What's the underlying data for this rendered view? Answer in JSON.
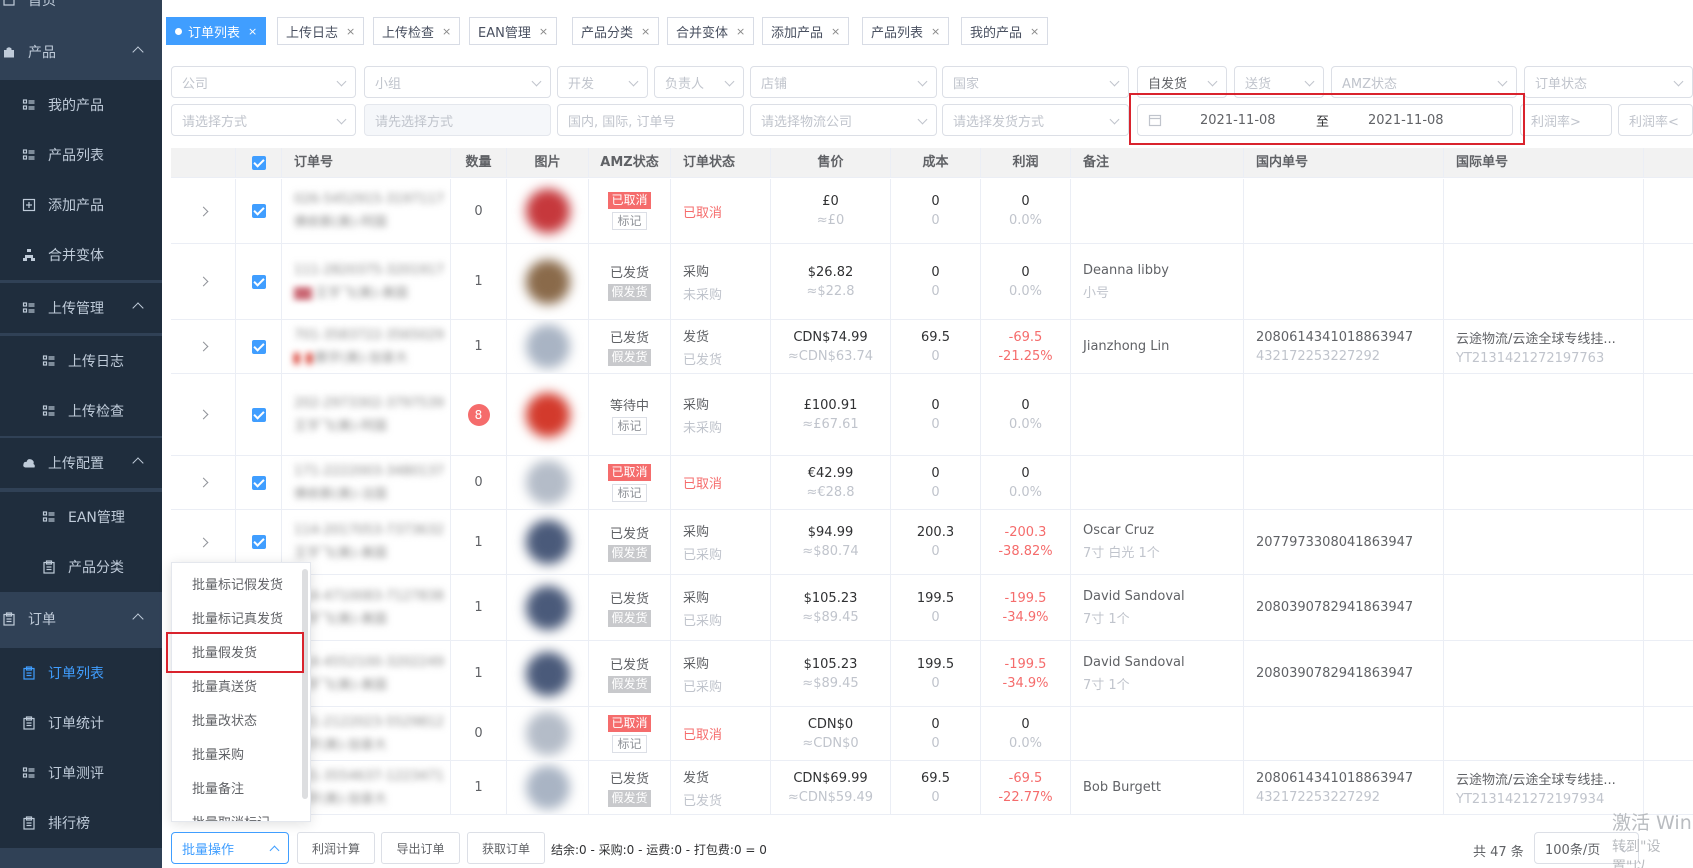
{
  "sidebar": {
    "items": [
      {
        "label": "首页",
        "icon": "home-icon"
      },
      {
        "label": "产品",
        "icon": "bag-icon"
      },
      {
        "label": "我的产品",
        "icon": "list-icon"
      },
      {
        "label": "产品列表",
        "icon": "list-icon"
      },
      {
        "label": "添加产品",
        "icon": "add-box-icon"
      },
      {
        "label": "合并变体",
        "icon": "tree-icon"
      },
      {
        "label": "上传管理",
        "icon": "list-icon"
      },
      {
        "label": "上传日志",
        "icon": "list-icon"
      },
      {
        "label": "上传检查",
        "icon": "list-icon"
      },
      {
        "label": "上传配置",
        "icon": "cloud-upload-icon"
      },
      {
        "label": "EAN管理",
        "icon": "list-icon"
      },
      {
        "label": "产品分类",
        "icon": "clipboard-icon"
      },
      {
        "label": "订单",
        "icon": "clipboard-icon"
      },
      {
        "label": "订单列表",
        "icon": "clipboard-icon"
      },
      {
        "label": "订单统计",
        "icon": "clipboard-icon"
      },
      {
        "label": "订单测评",
        "icon": "list-icon"
      },
      {
        "label": "排行榜",
        "icon": "clipboard-icon"
      }
    ]
  },
  "tabs": [
    "订单列表",
    "上传日志",
    "上传检查",
    "EAN管理",
    "产品分类",
    "合并变体",
    "添加产品",
    "产品列表",
    "我的产品"
  ],
  "filters": {
    "company": "公司",
    "group": "小组",
    "developer": "开发",
    "owner": "负责人",
    "shop": "店铺",
    "country": "国家",
    "ship_type": "自发货",
    "delivery": "送货",
    "amz_status": "AMZ状态",
    "order_status": "订单状态",
    "method": "请选择方式",
    "method2": "请先选择方式",
    "order_no": "国内, 国际, 订单号",
    "logistics": "请选择物流公司",
    "ship_method": "请选择发货方式",
    "date_from": "2021-11-08",
    "date_sep": "至",
    "date_to": "2021-11-08",
    "profit_gt": "利润率>",
    "profit_lt": "利润率<"
  },
  "table": {
    "headers": [
      "订单号",
      "数量",
      "图片",
      "AMZ状态",
      "订单状态",
      "售价",
      "成本",
      "利润",
      "备注",
      "国内单号",
      "国际单号"
    ],
    "rows": [
      {
        "order": "026-5452915-3197117",
        "sub": "佛依斯(美)-阿国",
        "qty": "0",
        "amz": "已取消",
        "amz2": "标记",
        "amz_type": "cancel",
        "st": "已取消",
        "st2": "",
        "st_red": true,
        "price": "£0",
        "price2": "≈£0",
        "cost": "0",
        "cost2": "0",
        "profit": "0",
        "profit2": "0.0%",
        "neg": false,
        "note": "",
        "note2": "",
        "dom": "",
        "dom2": "",
        "intl": "",
        "intl2": "",
        "img": "#c6383c",
        "flag": ""
      },
      {
        "order": "111-2820375-3201917",
        "sub": "王宇飞(美)-美国",
        "qty": "1",
        "amz": "已发货",
        "amz2": "假发货",
        "amz_type": "shipped",
        "st": "采购",
        "st2": "未采购",
        "st_red": false,
        "price": "$26.82",
        "price2": "≈$22.8",
        "cost": "0",
        "cost2": "0",
        "profit": "0",
        "profit2": "0.0%",
        "neg": false,
        "note": "Deanna libby",
        "note2": "小号",
        "dom": "",
        "dom2": "",
        "intl": "",
        "intl2": "",
        "img": "#8a6a4a",
        "flag": "us"
      },
      {
        "order": "701-3583722-3565029",
        "sub": "鹏宇(美)-加拿大",
        "qty": "1",
        "amz": "已发货",
        "amz2": "假发货",
        "amz_type": "shipped",
        "st": "发货",
        "st2": "已发货",
        "st_red": false,
        "price": "CDN$74.99",
        "price2": "≈CDN$63.74",
        "cost": "69.5",
        "cost2": "0",
        "profit": "-69.5",
        "profit2": "-21.25%",
        "neg": true,
        "note": "Jianzhong Lin",
        "note2": "",
        "dom": "2080614341018863947",
        "dom2": "432172253227292",
        "intl": "云途物流/云途全球专线挂...",
        "intl2": "YT2131421272197763",
        "img": "#a9b4c4",
        "flag": "ca"
      },
      {
        "order": "202-2973302-3797539",
        "sub": "王宇飞(美)-阿国",
        "qty": "8",
        "amz": "等待中",
        "amz2": "标记",
        "amz_type": "waiting",
        "st": "采购",
        "st2": "未采购",
        "st_red": false,
        "price": "£100.91",
        "price2": "≈£67.61",
        "cost": "0",
        "cost2": "0",
        "profit": "0",
        "profit2": "0.0%",
        "neg": false,
        "note": "",
        "note2": "",
        "dom": "",
        "dom2": "",
        "intl": "",
        "intl2": "",
        "img": "#d33a2c",
        "flag": ""
      },
      {
        "order": "171-2222003-3480137",
        "sub": "佛依斯(美)-法国",
        "qty": "0",
        "amz": "已取消",
        "amz2": "标记",
        "amz_type": "cancel",
        "st": "已取消",
        "st2": "",
        "st_red": true,
        "price": "€42.99",
        "price2": "≈€28.8",
        "cost": "0",
        "cost2": "0",
        "profit": "0",
        "profit2": "0.0%",
        "neg": false,
        "note": "",
        "note2": "",
        "dom": "",
        "dom2": "",
        "intl": "",
        "intl2": "",
        "img": "#b4bcc8",
        "flag": ""
      },
      {
        "order": "114-2017053-7373632",
        "sub": "王宇飞(美)-美国",
        "qty": "1",
        "amz": "已发货",
        "amz2": "假发货",
        "amz_type": "shipped",
        "st": "采购",
        "st2": "已采购",
        "st_red": false,
        "price": "$94.99",
        "price2": "≈$80.74",
        "cost": "200.3",
        "cost2": "0",
        "profit": "-200.3",
        "profit2": "-38.82%",
        "neg": true,
        "note": "Oscar Cruz",
        "note2": "7寸 白光 1个",
        "dom": "2077973308041863947",
        "dom2": "",
        "intl": "",
        "intl2": "",
        "img": "#4a5a7a",
        "flag": ""
      },
      {
        "order": "114-4710083-7127838",
        "sub": "王宇飞(美)-美国",
        "qty": "1",
        "amz": "已发货",
        "amz2": "假发货",
        "amz_type": "shipped",
        "st": "采购",
        "st2": "已采购",
        "st_red": false,
        "price": "$105.23",
        "price2": "≈$89.45",
        "cost": "199.5",
        "cost2": "0",
        "profit": "-199.5",
        "profit2": "-34.9%",
        "neg": true,
        "note": "David Sandoval",
        "note2": "7寸 1个",
        "dom": "2080390782941863947",
        "dom2": "",
        "intl": "",
        "intl2": "",
        "img": "#4a5a7a",
        "flag": ""
      },
      {
        "order": "114-4552100-3202249",
        "sub": "王宇飞(美)-美国",
        "qty": "1",
        "amz": "已发货",
        "amz2": "假发货",
        "amz_type": "shipped",
        "st": "采购",
        "st2": "已采购",
        "st_red": false,
        "price": "$105.23",
        "price2": "≈$89.45",
        "cost": "199.5",
        "cost2": "0",
        "profit": "-199.5",
        "profit2": "-34.9%",
        "neg": true,
        "note": "David Sandoval",
        "note2": "7寸 1个",
        "dom": "2080390782941863947",
        "dom2": "",
        "intl": "",
        "intl2": "",
        "img": "#4a5a7a",
        "flag": ""
      },
      {
        "order": "701-2122023-5529812",
        "sub": "鹏宇(美)-加拿大",
        "qty": "0",
        "amz": "已取消",
        "amz2": "标记",
        "amz_type": "cancel",
        "st": "已取消",
        "st2": "",
        "st_red": true,
        "price": "CDN$0",
        "price2": "≈CDN$0",
        "cost": "0",
        "cost2": "0",
        "profit": "0",
        "profit2": "0.0%",
        "neg": false,
        "note": "",
        "note2": "",
        "dom": "",
        "dom2": "",
        "intl": "",
        "intl2": "",
        "img": "#b4bcc8",
        "flag": ""
      },
      {
        "order": "701-3554637-1223471",
        "sub": "鹏宇(美)-加拿大",
        "qty": "1",
        "amz": "已发货",
        "amz2": "假发货",
        "amz_type": "shipped",
        "st": "发货",
        "st2": "已发货",
        "st_red": false,
        "price": "CDN$69.99",
        "price2": "≈CDN$59.49",
        "cost": "69.5",
        "cost2": "0",
        "profit": "-69.5",
        "profit2": "-22.77%",
        "neg": true,
        "note": "Bob Burgett",
        "note2": "",
        "dom": "2080614341018863947",
        "dom2": "432172253227292",
        "intl": "云途物流/云途全球专线挂...",
        "intl2": "YT2131421272197934",
        "img": "#a9b4c4",
        "flag": ""
      }
    ]
  },
  "dropdown": [
    "批量标记假发货",
    "批量标记真发货",
    "批量假发货",
    "批量真送货",
    "批量改状态",
    "批量采购",
    "批量备注",
    "批量取消标记"
  ],
  "footer": {
    "batch": "批量操作",
    "profit_calc": "利润计算",
    "export": "导出订单",
    "fetch": "获取订单",
    "summary": "结余:0 - 采购:0 - 运费:0 - 打包费:0 = 0",
    "total": "共 47 条",
    "page_size": "100条/页"
  },
  "watermark": {
    "line1": "激活 Win",
    "line2": "转到\"设置\"以"
  },
  "colors": {
    "sidebar_bg": "#304156",
    "accent": "#409eff",
    "danger": "#f56c6c",
    "highlight": "#d9232d"
  }
}
